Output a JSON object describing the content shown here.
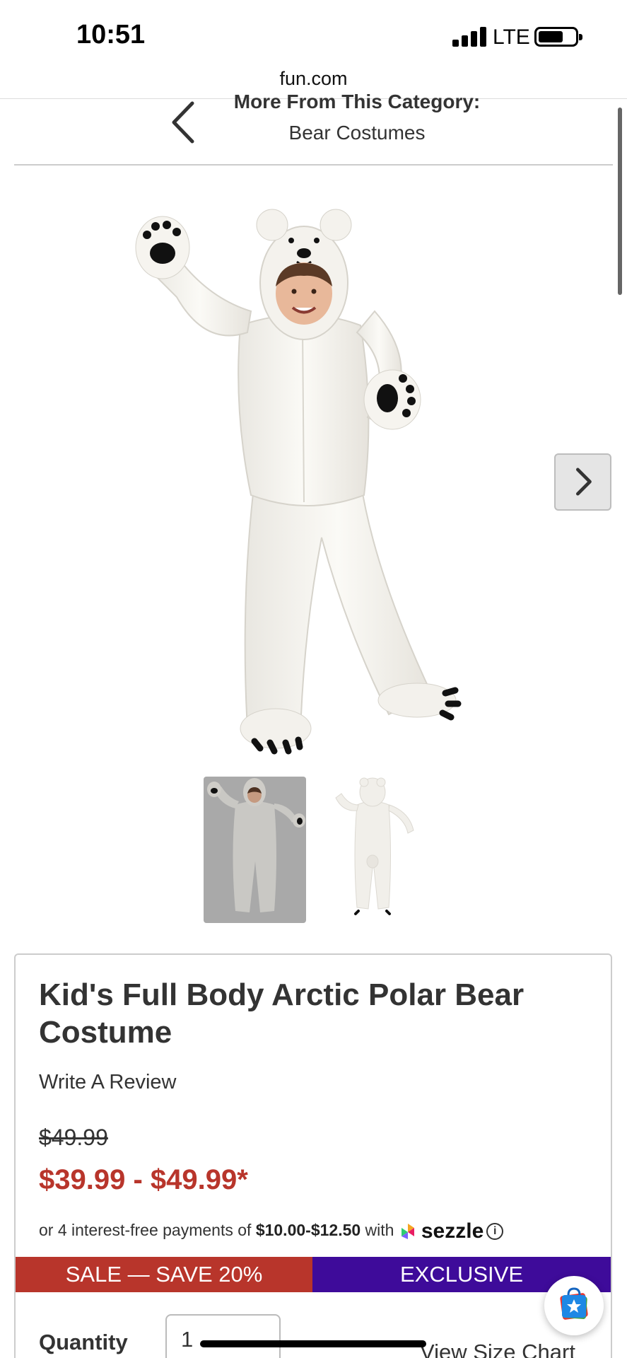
{
  "status_bar": {
    "time": "10:51",
    "network": "LTE"
  },
  "browser": {
    "url": "fun.com"
  },
  "category_nav": {
    "heading": "More From This Category:",
    "category": "Bear Costumes"
  },
  "product": {
    "title": "Kid's Full Body Arctic Polar Bear Costume",
    "review_link": "Write A Review",
    "original_price": "$49.99",
    "sale_price": "$39.99 - $49.99*",
    "installments": {
      "prefix": "or 4 interest-free payments of ",
      "amount": "$10.00-$12.50",
      "suffix": " with",
      "provider": "sezzle"
    },
    "banners": {
      "sale": "SALE — SAVE 20%",
      "exclusive": "EXCLUSIVE"
    },
    "quantity_label": "Quantity",
    "quantity_value": "1",
    "size_chart_link": "View Size Chart"
  },
  "images": {
    "count": 2,
    "active_index": 0
  },
  "colors": {
    "sale_red": "#b8352b",
    "exclusive_purple": "#3e0b9a",
    "text": "#333333"
  }
}
